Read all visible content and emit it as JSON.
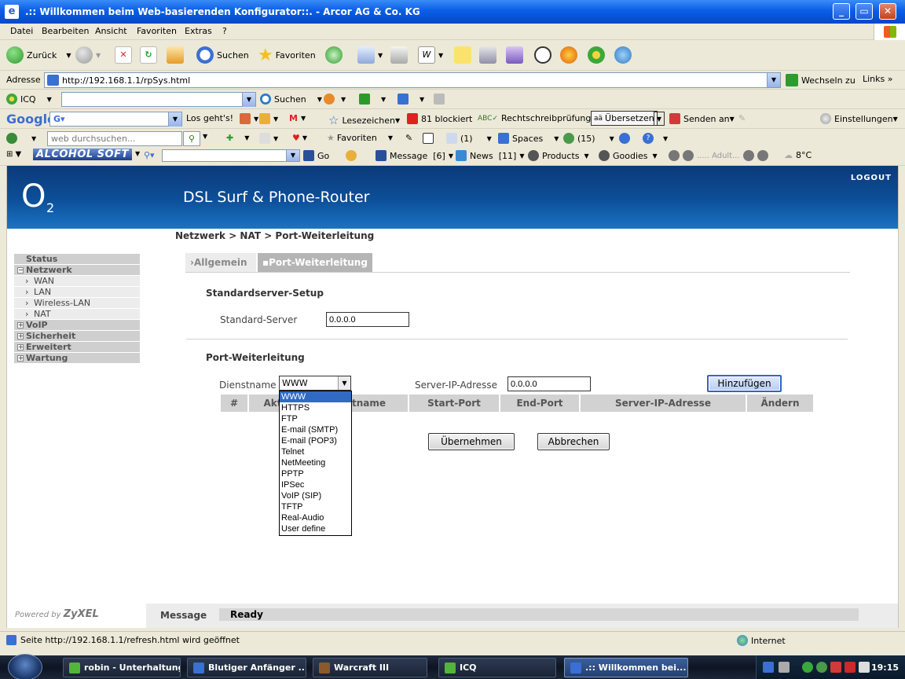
{
  "window": {
    "title": ".:: Willkommen beim Web-basierenden Konfigurator::. - Arcor AG & Co. KG"
  },
  "menu": [
    "Datei",
    "Bearbeiten",
    "Ansicht",
    "Favoriten",
    "Extras",
    "?"
  ],
  "toolbar": {
    "back": "Zurück",
    "search": "Suchen",
    "favorites": "Favoriten"
  },
  "address": {
    "label": "Adresse",
    "url": "http://192.168.1.1/rpSys.html",
    "go": "Wechseln zu",
    "links": "Links"
  },
  "icq_bar": {
    "icq": "ICQ",
    "search": "Suchen"
  },
  "google_bar": {
    "brand": "Google",
    "go": "Los geht's!",
    "bookmarks": "Lesezeichen",
    "blocked": "81 blockiert",
    "spell": "Rechtschreibprüfung",
    "translate": "Übersetzen",
    "send": "Senden an",
    "settings": "Einstellungen"
  },
  "web_bar": {
    "placeholder": "web durchsuchen...",
    "favorites": "Favoriten",
    "mail_count": "(1)",
    "spaces": "Spaces",
    "contacts": "(15)"
  },
  "alcohol_bar": {
    "brand": "ALCOHOL SOFT",
    "go": "Go",
    "message": "Message",
    "message_count": "[6]",
    "news": "News",
    "news_count": "[11]",
    "products": "Products",
    "goodies": "Goodies",
    "player": "..... Adult...",
    "weather": "8°C"
  },
  "router": {
    "brand": "O",
    "brand_sub": "2",
    "title": "DSL Surf & Phone-Router",
    "logout": "LOGOUT",
    "breadcrumb": "Netzwerk > NAT > Port-Weiterleitung",
    "nav": [
      {
        "label": "Status",
        "type": "top",
        "sign": ""
      },
      {
        "label": "Netzwerk",
        "type": "top",
        "sign": "−"
      },
      {
        "label": "WAN",
        "type": "sub"
      },
      {
        "label": "LAN",
        "type": "sub"
      },
      {
        "label": "Wireless-LAN",
        "type": "sub"
      },
      {
        "label": "NAT",
        "type": "sub"
      },
      {
        "label": "VoIP",
        "type": "top",
        "sign": "+"
      },
      {
        "label": "Sicherheit",
        "type": "top",
        "sign": "+"
      },
      {
        "label": "Erweitert",
        "type": "top",
        "sign": "+"
      },
      {
        "label": "Wartung",
        "type": "top",
        "sign": "+"
      }
    ],
    "tabs": {
      "general": "Allgemein",
      "portfw": "Port-Weiterleitung"
    },
    "std_section": "Standardserver-Setup",
    "std_label": "Standard-Server",
    "std_value": "0.0.0.0",
    "pf_section": "Port-Weiterleitung",
    "service_label": "Dienstname",
    "service_value": "WWW",
    "server_ip_label": "Server-IP-Adresse",
    "server_ip_value": "0.0.0.0",
    "add_button": "Hinzufügen",
    "table_headers": [
      "#",
      "Akt",
      "tname",
      "Start-Port",
      "End-Port",
      "Server-IP-Adresse",
      "Ändern"
    ],
    "dropdown_options": [
      "WWW",
      "HTTPS",
      "FTP",
      "E-mail (SMTP)",
      "E-mail (POP3)",
      "Telnet",
      "NetMeeting",
      "PPTP",
      "IPSec",
      "VoIP (SIP)",
      "TFTP",
      "Real-Audio",
      "User define"
    ],
    "apply_button": "Übernehmen",
    "cancel_button": "Abbrechen",
    "powered_by": "Powered by",
    "zyxel": "ZyXEL",
    "message_label": "Message",
    "message_value": "Ready"
  },
  "statusbar": {
    "text": "Seite http://192.168.1.1/refresh.html wird geöffnet",
    "zone": "Internet"
  },
  "taskbar": {
    "tasks": [
      {
        "label": "robin - Unterhaltung",
        "color": "#53b53a"
      },
      {
        "label": "Blutiger Anfänger ...",
        "color": "#3a6fd3"
      },
      {
        "label": "Warcraft III",
        "color": "#8a5a2a"
      },
      {
        "label": "ICQ",
        "color": "#53b53a"
      },
      {
        "label": ".:: Willkommen bei...",
        "color": "#3a6fd3"
      }
    ],
    "clock": "19:15"
  }
}
